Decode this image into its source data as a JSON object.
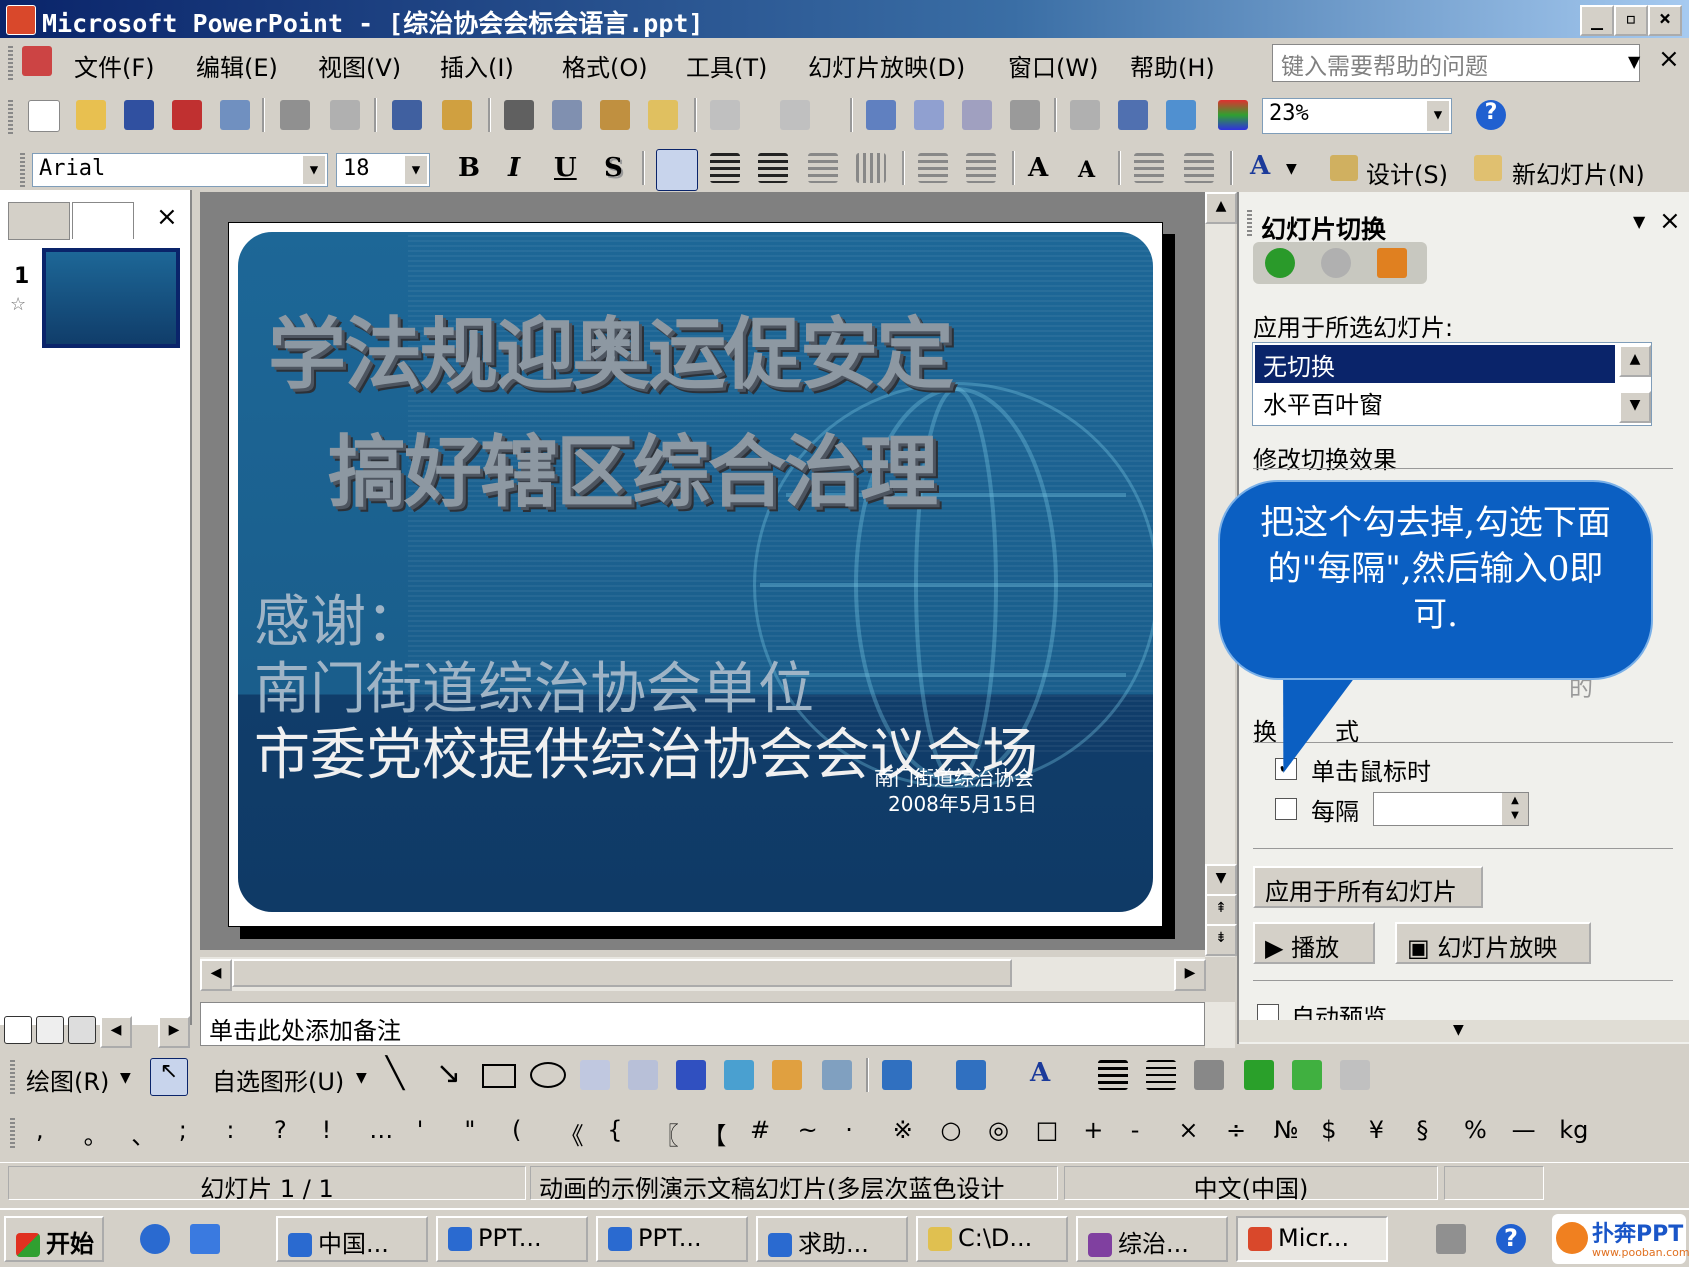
{
  "window": {
    "title": "Microsoft PowerPoint - [综治协会会标会语言.ppt]"
  },
  "menu": {
    "items": [
      "文件(F)",
      "编辑(E)",
      "视图(V)",
      "插入(I)",
      "格式(O)",
      "工具(T)",
      "幻灯片放映(D)",
      "窗口(W)",
      "帮助(H)"
    ],
    "help_placeholder": "键入需要帮助的问题"
  },
  "toolbar": {
    "zoom": "23%"
  },
  "format": {
    "font": "Arial",
    "size": "18",
    "design_label": "设计(S)",
    "new_slide_label": "新幻灯片(N)"
  },
  "left_panel": {
    "slide_number": "1"
  },
  "slide": {
    "title_line1": "学法规迎奥运促安定",
    "title_line2": "搞好辖区综合治理",
    "thanks_line1": "感谢：",
    "thanks_line2": "南门街道综治协会单位",
    "thanks_line3": "市委党校提供综治协会会议会场",
    "footer_org": "南门街道综治协会",
    "footer_date": "2008年5月15日"
  },
  "notes": {
    "placeholder": "单击此处添加备注"
  },
  "task_pane": {
    "title": "幻灯片切换",
    "apply_label": "应用于所选幻灯片:",
    "list_items": [
      "无切换",
      "水平百叶窗"
    ],
    "modify_label": "修改切换效果",
    "hidden_fragment": "的",
    "advance_label_left": "换",
    "advance_label_right": "式",
    "on_click_label": "单击鼠标时",
    "on_click_checked": true,
    "every_label": "每隔",
    "every_checked": false,
    "apply_all_button": "应用于所有幻灯片",
    "play_button": "播放",
    "slideshow_button": "幻灯片放映",
    "autopreview_label": "自动预览"
  },
  "callout": {
    "text": "把这个勾去掉,勾选下面的\"每隔\",然后输入0即可."
  },
  "drawing": {
    "draw_label": "绘图(R)",
    "autoshapes_label": "自选图形(U)"
  },
  "symbols": [
    ",",
    "。",
    "、",
    ";",
    ":",
    "?",
    "!",
    "…",
    "'",
    "\"",
    "(",
    "《",
    "{",
    "〖",
    "【",
    "#",
    "~",
    "·",
    "※",
    "○",
    "◎",
    "□",
    "+",
    "-",
    "×",
    "÷",
    "№",
    "$",
    "¥",
    "§",
    "%",
    "—",
    "kg"
  ],
  "status": {
    "slide": "幻灯片 1 / 1",
    "design": "动画的示例演示文稿幻灯片(多层次蓝色设计",
    "language": "中文(中国)"
  },
  "taskbar": {
    "start": "开始",
    "tasks": [
      "中国...",
      "PPT...",
      "PPT...",
      "求助...",
      "C:\\D...",
      "综治...",
      "Micr..."
    ],
    "watermark": "扑奔PPT",
    "watermark_url": "www.pooban.com"
  }
}
